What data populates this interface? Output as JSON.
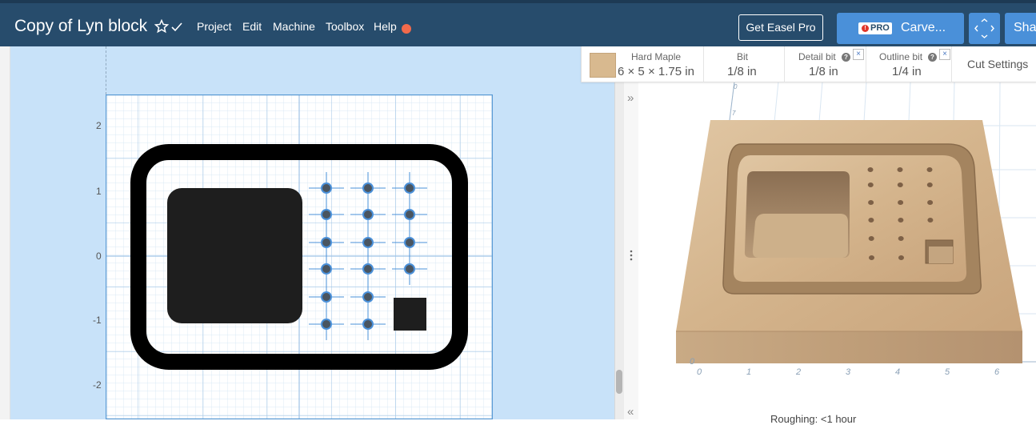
{
  "header": {
    "title": "Copy of Lyn block",
    "menu": [
      "Project",
      "Edit",
      "Machine",
      "Toolbox",
      "Help"
    ],
    "get_pro_label": "Get Easel Pro",
    "pro_badge": "PRO",
    "carve_label": "Carve...",
    "share_label": "Share"
  },
  "canvas": {
    "y_axis_labels": [
      "2",
      "1",
      "0",
      "-1",
      "-2"
    ]
  },
  "settings_bar": {
    "material_name": "Hard Maple",
    "material_dims": "6 × 5 × 1.75 in",
    "bit_label": "Bit",
    "bit_value": "1/8 in",
    "detail_bit_label": "Detail bit",
    "detail_bit_value": "1/8 in",
    "outline_bit_label": "Outline bit",
    "outline_bit_value": "1/4 in",
    "cut_settings_label": "Cut Settings"
  },
  "preview": {
    "x_axis_labels": [
      "0",
      "1",
      "2",
      "3",
      "4",
      "5",
      "6"
    ],
    "y_axis_labels": [
      "0",
      "7",
      "0"
    ],
    "roughing_label": "Roughing: <1 hour"
  },
  "colors": {
    "header_bg": "#274c6c",
    "accent_blue": "#4a90d9",
    "canvas_bg": "#c8e2f9",
    "help_dot": "#f26a4b",
    "wood": "#d8b98f"
  }
}
